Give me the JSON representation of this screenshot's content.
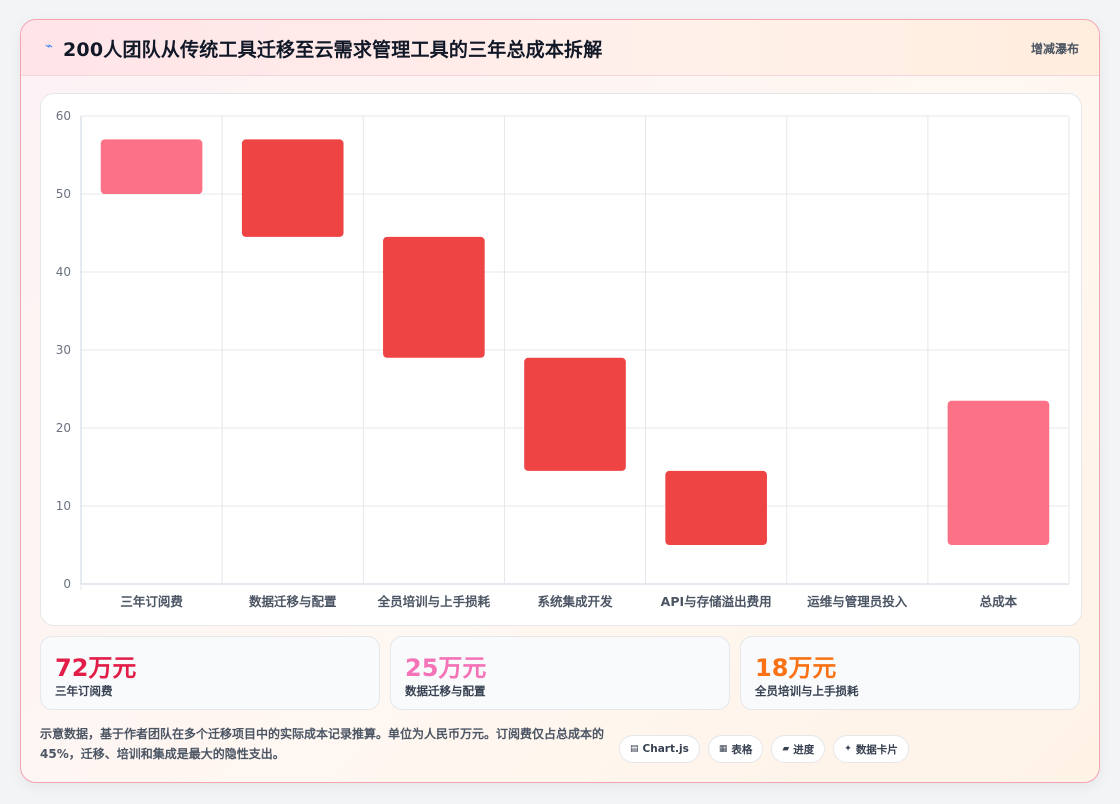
{
  "header": {
    "icon": "chart-trend-icon",
    "title": "200人团队从传统工具迁移至云需求管理工具的三年总成本拆解",
    "badge": "增减瀑布"
  },
  "chart_data": {
    "type": "bar",
    "subtype": "waterfall",
    "categories": [
      "三年订阅费",
      "数据迁移与配置",
      "全员培训与上手损耗",
      "系统集成开发",
      "API与存储溢出费用",
      "运维与管理员投入",
      "总成本"
    ],
    "ranges": [
      [
        50,
        57
      ],
      [
        44.5,
        57
      ],
      [
        29,
        44.5
      ],
      [
        14.5,
        29
      ],
      [
        5,
        14.5
      ],
      null,
      [
        5,
        23.5
      ]
    ],
    "kinds": [
      "total",
      "delta",
      "delta",
      "delta",
      "delta",
      "delta",
      "total"
    ],
    "ylim": [
      0,
      60
    ],
    "yticks": [
      0,
      10,
      20,
      30,
      40,
      50,
      60
    ],
    "colors": {
      "total": "#fb7185",
      "delta": "#ef4444"
    },
    "grid": true,
    "legend": "none"
  },
  "stats": [
    {
      "value": "72万元",
      "label": "三年订阅费",
      "color": "#e11d48"
    },
    {
      "value": "25万元",
      "label": "数据迁移与配置",
      "color": "#f472b6"
    },
    {
      "value": "18万元",
      "label": "全员培训与上手损耗",
      "color": "#f97316"
    }
  ],
  "footnote": "示意数据，基于作者团队在多个迁移项目中的实际成本记录推算。单位为人民币万元。订阅费仅占总成本的45%，迁移、培训和集成是最大的隐性支出。",
  "chips": [
    {
      "icon": "chart-icon",
      "glyph": "▤",
      "label": "Chart.js"
    },
    {
      "icon": "table-icon",
      "glyph": "▦",
      "label": "表格"
    },
    {
      "icon": "progress-icon",
      "glyph": "▰",
      "label": "进度"
    },
    {
      "icon": "sparkle-icon",
      "glyph": "✦",
      "label": "数据卡片"
    }
  ]
}
